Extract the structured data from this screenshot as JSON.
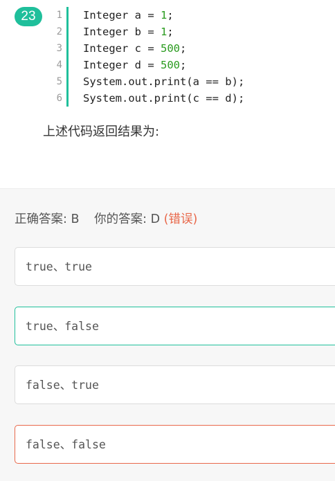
{
  "question": {
    "number": "23",
    "code_lines": [
      {
        "line": "1",
        "prefix": "Integer a = ",
        "value": "1",
        "suffix": ";"
      },
      {
        "line": "2",
        "prefix": "Integer b = ",
        "value": "1",
        "suffix": ";"
      },
      {
        "line": "3",
        "prefix": "Integer c = ",
        "value": "500",
        "suffix": ";"
      },
      {
        "line": "4",
        "prefix": "Integer d = ",
        "value": "500",
        "suffix": ";"
      },
      {
        "line": "5",
        "prefix": "System.out.print(a == b);",
        "value": "",
        "suffix": ""
      },
      {
        "line": "6",
        "prefix": "System.out.print(c == d);",
        "value": "",
        "suffix": ""
      }
    ],
    "text": "上述代码返回结果为:"
  },
  "result": {
    "correct_label": "正确答案:",
    "correct_value": "B",
    "your_label": "你的答案:",
    "your_value": "D",
    "status": "(错误)"
  },
  "options": [
    {
      "text": "true、true",
      "state": "normal"
    },
    {
      "text": "true、false",
      "state": "correct"
    },
    {
      "text": "false、true",
      "state": "normal"
    },
    {
      "text": "false、false",
      "state": "incorrect"
    }
  ],
  "colors": {
    "accent": "#1fbf9b",
    "error": "#e8684a",
    "number_literal": "#2a9b1f"
  }
}
